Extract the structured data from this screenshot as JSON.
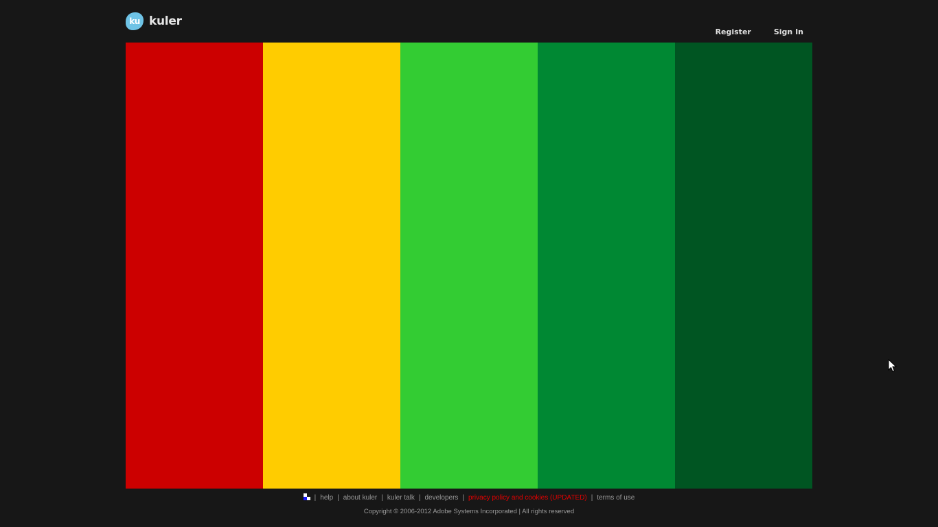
{
  "header": {
    "logo_mark": "ku",
    "logo_text": "kuler",
    "register_label": "Register",
    "signin_label": "Sign In"
  },
  "swatches": [
    {
      "color": "#CC0000"
    },
    {
      "color": "#FFCC00"
    },
    {
      "color": "#33CC33"
    },
    {
      "color": "#008833"
    },
    {
      "color": "#005522"
    }
  ],
  "footer": {
    "links": [
      {
        "label": "help"
      },
      {
        "label": "about kuler"
      },
      {
        "label": "kuler talk"
      },
      {
        "label": "developers"
      },
      {
        "label": "privacy policy and cookies (UPDATED)",
        "highlight": true
      },
      {
        "label": "terms of use"
      }
    ],
    "separator": "|",
    "copyright": "Copyright © 2006-2012 Adobe Systems Incorporated | All rights reserved"
  },
  "colors": {
    "background": "#171717",
    "logo_accent": "#6EC3E6",
    "highlight_link": "#E60000"
  },
  "icons": {
    "footer_icon": "checker-icon",
    "cursor": "arrow-cursor-icon"
  }
}
